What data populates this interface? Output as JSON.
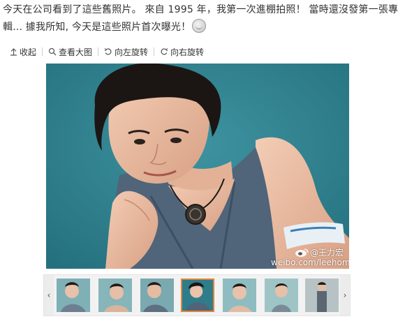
{
  "post": {
    "line1": "今天在公司看到了這些舊照片。 來自 1995 年，我第一次進棚拍照！ 當時還沒發第一張專",
    "line2": "輯... 據我所知, 今天是這些照片首次曝光！"
  },
  "toolbar": {
    "collapse_label": "收起",
    "view_large_label": "查看大图",
    "rotate_left_label": "向左旋转",
    "rotate_right_label": "向右旋转"
  },
  "photo": {
    "watermark_name": "@王力宏",
    "watermark_url": "weibo.com/leehom"
  },
  "gallery": {
    "thumbnail_count": 7,
    "active_index": 3
  }
}
